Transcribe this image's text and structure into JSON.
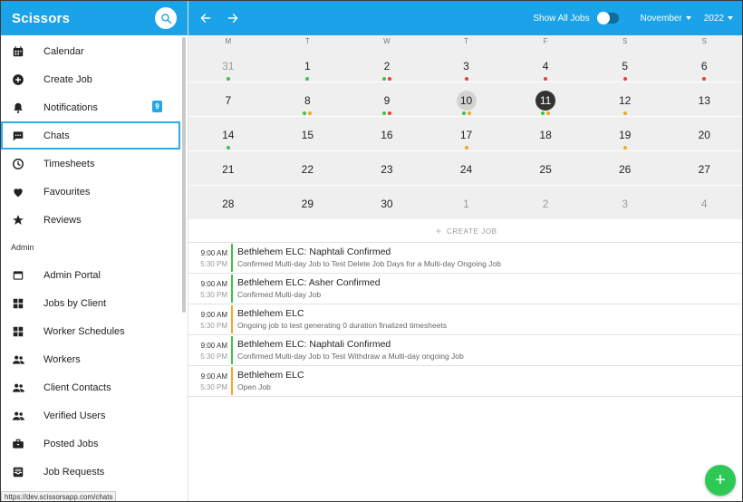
{
  "app": {
    "brand": "Scissors"
  },
  "sidebar": {
    "items": [
      {
        "label": "Calendar",
        "icon": "calendar-icon"
      },
      {
        "label": "Create Job",
        "icon": "add-circle-icon"
      },
      {
        "label": "Notifications",
        "icon": "bell-icon",
        "badge": "9"
      },
      {
        "label": "Chats",
        "icon": "chat-icon",
        "active": true
      },
      {
        "label": "Timesheets",
        "icon": "clock-icon"
      },
      {
        "label": "Favourites",
        "icon": "heart-icon"
      },
      {
        "label": "Reviews",
        "icon": "star-icon"
      }
    ],
    "admin_header": "Admin",
    "admin_items": [
      {
        "label": "Admin Portal",
        "icon": "window-icon"
      },
      {
        "label": "Jobs by Client",
        "icon": "grid-icon"
      },
      {
        "label": "Worker Schedules",
        "icon": "grid-icon"
      },
      {
        "label": "Workers",
        "icon": "people-icon"
      },
      {
        "label": "Client Contacts",
        "icon": "people-icon"
      },
      {
        "label": "Verified Users",
        "icon": "people-icon"
      },
      {
        "label": "Posted Jobs",
        "icon": "briefcase-icon"
      },
      {
        "label": "Job Requests",
        "icon": "inbox-icon"
      }
    ]
  },
  "topbar": {
    "show_all_label": "Show All Jobs",
    "month": "November",
    "year": "2022"
  },
  "calendar": {
    "weekdays": [
      "M",
      "T",
      "W",
      "T",
      "F",
      "S",
      "S"
    ],
    "colors": {
      "green": "#3cc24a",
      "orange": "#f5a623",
      "red": "#e8412c"
    },
    "weeks": [
      [
        {
          "d": "31",
          "muted": true,
          "dots": [
            "green"
          ]
        },
        {
          "d": "1",
          "dots": [
            "green"
          ]
        },
        {
          "d": "2",
          "dots": [
            "green",
            "red"
          ]
        },
        {
          "d": "3",
          "dots": [
            "red"
          ]
        },
        {
          "d": "4",
          "dots": [
            "red"
          ]
        },
        {
          "d": "5",
          "dots": [
            "red"
          ]
        },
        {
          "d": "6",
          "dots": [
            "red"
          ]
        }
      ],
      [
        {
          "d": "7",
          "dots": []
        },
        {
          "d": "8",
          "dots": [
            "green",
            "orange"
          ]
        },
        {
          "d": "9",
          "dots": [
            "green",
            "red"
          ]
        },
        {
          "d": "10",
          "today": true,
          "dots": [
            "green",
            "orange"
          ]
        },
        {
          "d": "11",
          "selected": true,
          "dots": [
            "green",
            "orange"
          ]
        },
        {
          "d": "12",
          "dots": [
            "orange"
          ]
        },
        {
          "d": "13",
          "dots": []
        }
      ],
      [
        {
          "d": "14",
          "dots": [
            "green"
          ]
        },
        {
          "d": "15",
          "dots": []
        },
        {
          "d": "16",
          "dots": []
        },
        {
          "d": "17",
          "dots": [
            "orange"
          ]
        },
        {
          "d": "18",
          "dots": []
        },
        {
          "d": "19",
          "dots": [
            "orange"
          ]
        },
        {
          "d": "20",
          "dots": []
        }
      ],
      [
        {
          "d": "21",
          "dots": []
        },
        {
          "d": "22",
          "dots": []
        },
        {
          "d": "23",
          "dots": []
        },
        {
          "d": "24",
          "dots": []
        },
        {
          "d": "25",
          "dots": []
        },
        {
          "d": "26",
          "dots": []
        },
        {
          "d": "27",
          "dots": []
        }
      ],
      [
        {
          "d": "28",
          "dots": []
        },
        {
          "d": "29",
          "dots": []
        },
        {
          "d": "30",
          "dots": []
        },
        {
          "d": "1",
          "muted": true,
          "dots": []
        },
        {
          "d": "2",
          "muted": true,
          "dots": []
        },
        {
          "d": "3",
          "muted": true,
          "dots": []
        },
        {
          "d": "4",
          "muted": true,
          "dots": []
        }
      ]
    ]
  },
  "create_job_label": "CREATE JOB",
  "jobs": [
    {
      "start": "9:00 AM",
      "end": "5:30 PM",
      "title": "Bethlehem ELC: Naphtali Confirmed",
      "subtitle": "Confirmed Multi-day Job to Test Delete Job Days for a Multi-day Ongoing Job",
      "color": "#3cc24a"
    },
    {
      "start": "9:00 AM",
      "end": "5:30 PM",
      "title": "Bethlehem ELC: Asher Confirmed",
      "subtitle": "Confirmed Multi-day Job",
      "color": "#3cc24a"
    },
    {
      "start": "9:00 AM",
      "end": "5:30 PM",
      "title": "Bethlehem ELC",
      "subtitle": "Ongoing job to test generating 0 duration finalized timesheets",
      "color": "#f5a623"
    },
    {
      "start": "9:00 AM",
      "end": "5:30 PM",
      "title": "Bethlehem ELC: Naphtali Confirmed",
      "subtitle": "Confirmed Multi-day Job to Test Withdraw a Multi-day ongoing Job",
      "color": "#3cc24a"
    },
    {
      "start": "9:00 AM",
      "end": "5:30 PM",
      "title": "Bethlehem ELC",
      "subtitle": "Open Job",
      "color": "#f5a623"
    }
  ],
  "status_url": "https://dev.scissorsapp.com/chats",
  "fab_label": "+"
}
